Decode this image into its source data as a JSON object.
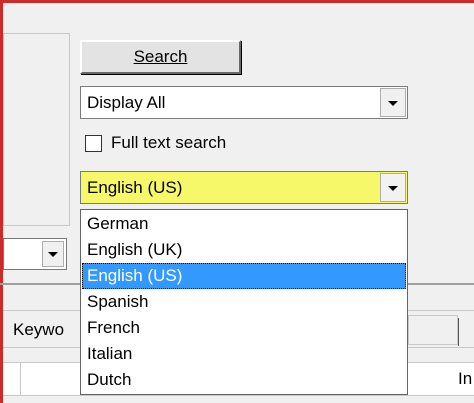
{
  "search_button": {
    "label": "Search"
  },
  "display_combo": {
    "value": "Display All"
  },
  "full_text_search": {
    "label": "Full text search",
    "checked": false
  },
  "language_combo": {
    "value": "English (US)",
    "highlight_color": "#f7f76a"
  },
  "language_dropdown": {
    "options": [
      "German",
      "English (UK)",
      "English (US)",
      "Spanish",
      "French",
      "Italian",
      "Dutch"
    ],
    "selected": "English (US)",
    "selection_color": "#3399ff"
  },
  "tabs": {
    "keyword_label": "Keywo"
  },
  "column_header": {
    "partial_label": "In"
  },
  "window": {
    "border_color": "#cf2a2a"
  }
}
